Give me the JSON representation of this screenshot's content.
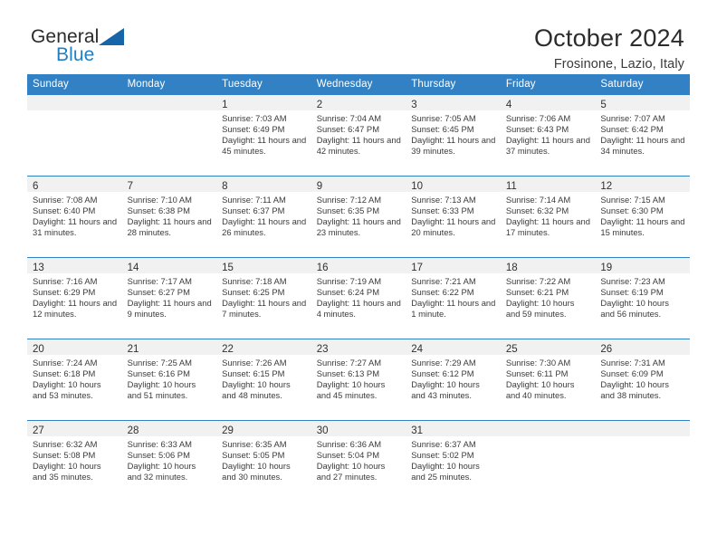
{
  "brand": {
    "name_top": "General",
    "name_bottom": "Blue",
    "accent_color": "#1f7fc4",
    "triangle_color": "#1565a8"
  },
  "header": {
    "title": "October 2024",
    "location": "Frosinone, Lazio, Italy"
  },
  "theme": {
    "header_row_bg": "#3281c4",
    "header_row_text": "#ffffff",
    "daynum_band_bg": "#f1f1f1",
    "row_divider": "#3281c4"
  },
  "weekday_headers": [
    "Sunday",
    "Monday",
    "Tuesday",
    "Wednesday",
    "Thursday",
    "Friday",
    "Saturday"
  ],
  "weeks": [
    [
      {
        "day": "",
        "sunrise": "",
        "sunset": "",
        "daylight": "",
        "empty": true
      },
      {
        "day": "",
        "sunrise": "",
        "sunset": "",
        "daylight": "",
        "empty": true
      },
      {
        "day": "1",
        "sunrise": "Sunrise: 7:03 AM",
        "sunset": "Sunset: 6:49 PM",
        "daylight": "Daylight: 11 hours and 45 minutes."
      },
      {
        "day": "2",
        "sunrise": "Sunrise: 7:04 AM",
        "sunset": "Sunset: 6:47 PM",
        "daylight": "Daylight: 11 hours and 42 minutes."
      },
      {
        "day": "3",
        "sunrise": "Sunrise: 7:05 AM",
        "sunset": "Sunset: 6:45 PM",
        "daylight": "Daylight: 11 hours and 39 minutes."
      },
      {
        "day": "4",
        "sunrise": "Sunrise: 7:06 AM",
        "sunset": "Sunset: 6:43 PM",
        "daylight": "Daylight: 11 hours and 37 minutes."
      },
      {
        "day": "5",
        "sunrise": "Sunrise: 7:07 AM",
        "sunset": "Sunset: 6:42 PM",
        "daylight": "Daylight: 11 hours and 34 minutes."
      }
    ],
    [
      {
        "day": "6",
        "sunrise": "Sunrise: 7:08 AM",
        "sunset": "Sunset: 6:40 PM",
        "daylight": "Daylight: 11 hours and 31 minutes."
      },
      {
        "day": "7",
        "sunrise": "Sunrise: 7:10 AM",
        "sunset": "Sunset: 6:38 PM",
        "daylight": "Daylight: 11 hours and 28 minutes."
      },
      {
        "day": "8",
        "sunrise": "Sunrise: 7:11 AM",
        "sunset": "Sunset: 6:37 PM",
        "daylight": "Daylight: 11 hours and 26 minutes."
      },
      {
        "day": "9",
        "sunrise": "Sunrise: 7:12 AM",
        "sunset": "Sunset: 6:35 PM",
        "daylight": "Daylight: 11 hours and 23 minutes."
      },
      {
        "day": "10",
        "sunrise": "Sunrise: 7:13 AM",
        "sunset": "Sunset: 6:33 PM",
        "daylight": "Daylight: 11 hours and 20 minutes."
      },
      {
        "day": "11",
        "sunrise": "Sunrise: 7:14 AM",
        "sunset": "Sunset: 6:32 PM",
        "daylight": "Daylight: 11 hours and 17 minutes."
      },
      {
        "day": "12",
        "sunrise": "Sunrise: 7:15 AM",
        "sunset": "Sunset: 6:30 PM",
        "daylight": "Daylight: 11 hours and 15 minutes."
      }
    ],
    [
      {
        "day": "13",
        "sunrise": "Sunrise: 7:16 AM",
        "sunset": "Sunset: 6:29 PM",
        "daylight": "Daylight: 11 hours and 12 minutes."
      },
      {
        "day": "14",
        "sunrise": "Sunrise: 7:17 AM",
        "sunset": "Sunset: 6:27 PM",
        "daylight": "Daylight: 11 hours and 9 minutes."
      },
      {
        "day": "15",
        "sunrise": "Sunrise: 7:18 AM",
        "sunset": "Sunset: 6:25 PM",
        "daylight": "Daylight: 11 hours and 7 minutes."
      },
      {
        "day": "16",
        "sunrise": "Sunrise: 7:19 AM",
        "sunset": "Sunset: 6:24 PM",
        "daylight": "Daylight: 11 hours and 4 minutes."
      },
      {
        "day": "17",
        "sunrise": "Sunrise: 7:21 AM",
        "sunset": "Sunset: 6:22 PM",
        "daylight": "Daylight: 11 hours and 1 minute."
      },
      {
        "day": "18",
        "sunrise": "Sunrise: 7:22 AM",
        "sunset": "Sunset: 6:21 PM",
        "daylight": "Daylight: 10 hours and 59 minutes."
      },
      {
        "day": "19",
        "sunrise": "Sunrise: 7:23 AM",
        "sunset": "Sunset: 6:19 PM",
        "daylight": "Daylight: 10 hours and 56 minutes."
      }
    ],
    [
      {
        "day": "20",
        "sunrise": "Sunrise: 7:24 AM",
        "sunset": "Sunset: 6:18 PM",
        "daylight": "Daylight: 10 hours and 53 minutes."
      },
      {
        "day": "21",
        "sunrise": "Sunrise: 7:25 AM",
        "sunset": "Sunset: 6:16 PM",
        "daylight": "Daylight: 10 hours and 51 minutes."
      },
      {
        "day": "22",
        "sunrise": "Sunrise: 7:26 AM",
        "sunset": "Sunset: 6:15 PM",
        "daylight": "Daylight: 10 hours and 48 minutes."
      },
      {
        "day": "23",
        "sunrise": "Sunrise: 7:27 AM",
        "sunset": "Sunset: 6:13 PM",
        "daylight": "Daylight: 10 hours and 45 minutes."
      },
      {
        "day": "24",
        "sunrise": "Sunrise: 7:29 AM",
        "sunset": "Sunset: 6:12 PM",
        "daylight": "Daylight: 10 hours and 43 minutes."
      },
      {
        "day": "25",
        "sunrise": "Sunrise: 7:30 AM",
        "sunset": "Sunset: 6:11 PM",
        "daylight": "Daylight: 10 hours and 40 minutes."
      },
      {
        "day": "26",
        "sunrise": "Sunrise: 7:31 AM",
        "sunset": "Sunset: 6:09 PM",
        "daylight": "Daylight: 10 hours and 38 minutes."
      }
    ],
    [
      {
        "day": "27",
        "sunrise": "Sunrise: 6:32 AM",
        "sunset": "Sunset: 5:08 PM",
        "daylight": "Daylight: 10 hours and 35 minutes."
      },
      {
        "day": "28",
        "sunrise": "Sunrise: 6:33 AM",
        "sunset": "Sunset: 5:06 PM",
        "daylight": "Daylight: 10 hours and 32 minutes."
      },
      {
        "day": "29",
        "sunrise": "Sunrise: 6:35 AM",
        "sunset": "Sunset: 5:05 PM",
        "daylight": "Daylight: 10 hours and 30 minutes."
      },
      {
        "day": "30",
        "sunrise": "Sunrise: 6:36 AM",
        "sunset": "Sunset: 5:04 PM",
        "daylight": "Daylight: 10 hours and 27 minutes."
      },
      {
        "day": "31",
        "sunrise": "Sunrise: 6:37 AM",
        "sunset": "Sunset: 5:02 PM",
        "daylight": "Daylight: 10 hours and 25 minutes."
      },
      {
        "day": "",
        "sunrise": "",
        "sunset": "",
        "daylight": "",
        "empty": true
      },
      {
        "day": "",
        "sunrise": "",
        "sunset": "",
        "daylight": "",
        "empty": true
      }
    ]
  ]
}
